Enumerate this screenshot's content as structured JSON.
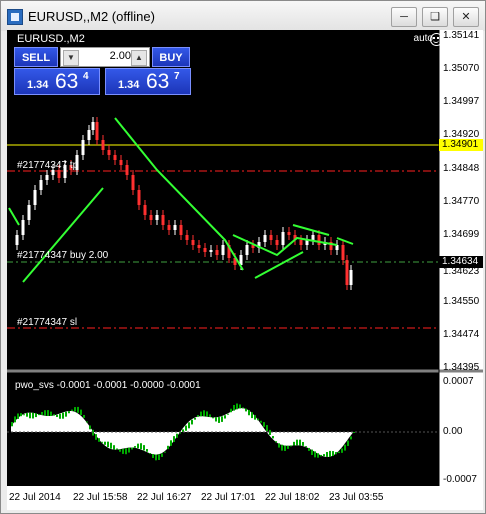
{
  "window": {
    "title": "EURUSD,,M2 (offline)",
    "minimize_icon": "minimize-icon",
    "restore_icon": "restore-icon",
    "close_icon": "close-icon"
  },
  "chart": {
    "symbol_label": "EURUSD.,M2",
    "auto_label": "auto",
    "price_ticks": [
      "1.35141",
      "1.35070",
      "1.34997",
      "1.34920",
      "1.34848",
      "1.34770",
      "1.34699",
      "1.34623",
      "1.34550",
      "1.34474",
      "1.34395"
    ],
    "highlight_tags": [
      {
        "value": "1.34901",
        "color": "#ffff00",
        "text_color": "#000000"
      },
      {
        "value": "1.34634",
        "color": "#000000",
        "text_color": "#ffffff"
      }
    ],
    "time_labels": [
      "22 Jul 2014",
      "22 Jul 15:58",
      "22 Jul 16:27",
      "22 Jul 17:01",
      "22 Jul 18:02",
      "23 Jul 03:55"
    ],
    "orders": {
      "tp_label": "#21774347 tp",
      "buy_label": "#21774347 buy 2.00",
      "sl_label": "#21774347 sl"
    }
  },
  "one_click": {
    "sell_label": "SELL",
    "buy_label": "BUY",
    "lot_value": "2.00",
    "sell_price": {
      "small": "1.34",
      "big": "63",
      "sup": "4"
    },
    "buy_price": {
      "small": "1.34",
      "big": "63",
      "sup": "7"
    }
  },
  "indicator": {
    "label": "pwo_svs -0.0001 -0.0001 -0.0000 -0.0001",
    "ticks": [
      "0.0007",
      "0.00",
      "-0.0007"
    ]
  },
  "colors": {
    "candle_up": "#ffffff",
    "candle_down": "#ff3030",
    "trend_line": "#33ff33",
    "tp_line": "#ff2020",
    "sl_line": "#ff2020",
    "yellow_line": "#ffff00",
    "indicator_red": "#ff0000",
    "indicator_blue": "#1f4bff",
    "indicator_green": "#00aa00",
    "indicator_white": "#ffffff"
  }
}
